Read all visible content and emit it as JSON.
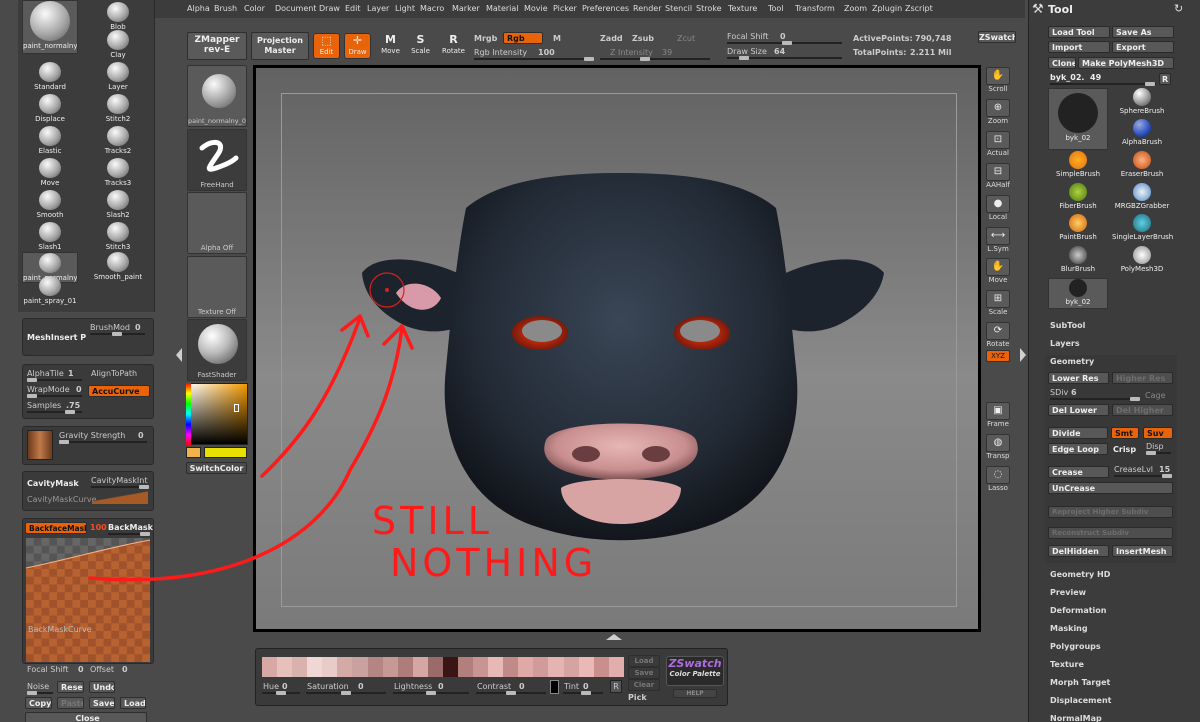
{
  "menu": [
    "Alpha",
    "Brush",
    "Color",
    "Document",
    "Draw",
    "Edit",
    "Layer",
    "Light",
    "Macro",
    "Marker",
    "Material",
    "Movie",
    "Picker",
    "Preferences",
    "Render",
    "Stencil",
    "Stroke",
    "Texture",
    "Tool",
    "Transform",
    "Zoom",
    "Zplugin",
    "Zscript"
  ],
  "topbar": {
    "zmapper": "ZMapper",
    "zmapper_sub": "rev-E",
    "projection": "Projection",
    "projection_sub": "Master",
    "edit": "Edit",
    "draw": "Draw",
    "move": "Move",
    "scale": "Scale",
    "rotate": "Rotate",
    "mrgb": "Mrgb",
    "rgb": "Rgb",
    "m": "M",
    "rgb_intensity": "Rgb Intensity",
    "rgb_intensity_value": "100",
    "zadd": "Zadd",
    "zsub": "Zsub",
    "zcut": "Zcut",
    "z_intensity": "Z Intensity",
    "z_intensity_value": "39",
    "focal_shift": "Focal Shift",
    "focal_shift_value": "0",
    "draw_size": "Draw Size",
    "draw_size_value": "64",
    "active_points": "ActivePoints:",
    "active_points_value": "790,748",
    "total_points": "TotalPoints:",
    "total_points_value": "2.211",
    "total_points_unit": "Mil",
    "zswatch": "ZSwatch"
  },
  "brushes": [
    {
      "name": "paint_normalny_0"
    },
    {
      "name": "Blob"
    },
    {
      "name": "Clay"
    },
    {
      "name": "Standard"
    },
    {
      "name": "Layer"
    },
    {
      "name": "Displace"
    },
    {
      "name": "Stitch2"
    },
    {
      "name": "Elastic"
    },
    {
      "name": "Tracks2"
    },
    {
      "name": "Move"
    },
    {
      "name": "Tracks3"
    },
    {
      "name": "Smooth"
    },
    {
      "name": "Slash2"
    },
    {
      "name": "Slash1"
    },
    {
      "name": "Stitch3"
    },
    {
      "name": "paint_normalny_0"
    },
    {
      "name": "Smooth_paint"
    },
    {
      "name": "paint_spray_01"
    }
  ],
  "leftpanel": {
    "meshinsert": "MeshInsert P",
    "brushmod": "BrushMod",
    "brushmod_value": "0",
    "alphatile": "AlphaTile",
    "alphatile_value": "1",
    "aligntopath": "AlignToPath",
    "wrapmode": "WrapMode",
    "wrapmode_value": "0",
    "accucurve": "AccuCurve",
    "samples": "Samples",
    "samples_value": ".75",
    "gravity": "Gravity Strength",
    "gravity_value": "0",
    "cavitymask": "CavityMask",
    "cavitymaskint": "CavityMaskInt",
    "cavitymaskcurve": "CavityMaskCurve",
    "backfacemask": "BackfaceMask",
    "backmask_value": "100",
    "backmask": "BackMask",
    "backmaskcurve": "BackMaskCurve",
    "focal_shift": "Focal Shift",
    "focal_shift_value": "0",
    "offset": "Offset",
    "offset_value": "0",
    "noise": "Noise",
    "reset": "Reset",
    "undo": "Undo",
    "copy": "Copy",
    "paste": "Paste",
    "save": "Save",
    "load": "Load",
    "close": "Close"
  },
  "sidecol": {
    "tile1": "paint_normalny_0",
    "tile2": "FreeHand",
    "tile3": "Alpha Off",
    "tile4": "Texture Off",
    "tile5": "FastShader",
    "switchcolor": "SwitchColor"
  },
  "vtools": [
    "Scroll",
    "Zoom",
    "Actual",
    "AAHalf",
    "Local",
    "L.Sym",
    "Move",
    "Scale",
    "Rotate",
    "XYZ",
    "Frame",
    "Transp",
    "Lasso"
  ],
  "annotation": {
    "line1": "STILL",
    "line2": "NOTHING",
    "color": "#ff1a1a"
  },
  "swatch": {
    "colors": [
      "#d8a9a4",
      "#e6c1bb",
      "#d9b2ad",
      "#eed7d4",
      "#e8ccc9",
      "#d4aaa6",
      "#c9a19e",
      "#b48583",
      "#c79995",
      "#ae7c79",
      "#d5a6a3",
      "#9c6b69",
      "#3a1515",
      "#b37f7d",
      "#c99592",
      "#e7b9b6",
      "#c08a88",
      "#dfa9a6",
      "#d09b98",
      "#e4b4b1",
      "#d6a4a0",
      "#eab8b5",
      "#c88f8d",
      "#e2aeab"
    ],
    "load": "Load",
    "save": "Save",
    "clear": "Clear",
    "brand": "ZSwatch",
    "brand_sub": "Color Palette",
    "help": "HELP",
    "hue": "Hue",
    "hue_value": "0",
    "saturation": "Saturation",
    "saturation_value": "0",
    "lightness": "Lightness",
    "lightness_value": "0",
    "contrast": "Contrast",
    "contrast_value": "0",
    "tint": "Tint",
    "tint_value": "0",
    "pick": "Pick"
  },
  "tool": {
    "title": "Tool",
    "load_tool": "Load Tool",
    "save_as": "Save As",
    "import": "Import",
    "export": "Export",
    "clone": "Clone",
    "make_polymesh": "Make PolyMesh3D",
    "current": "byk_02.",
    "current_count": "49",
    "r": "R",
    "items": [
      "byk_02",
      "SphereBrush",
      "AlphaBrush",
      "SimpleBrush",
      "EraserBrush",
      "FiberBrush",
      "MRGBZGrabber",
      "PaintBrush",
      "SingleLayerBrush",
      "BlurBrush",
      "PolyMesh3D",
      "byk_02"
    ],
    "subtool": "SubTool",
    "layers": "Layers",
    "geometry": "Geometry",
    "lower_res": "Lower Res",
    "higher_res": "Higher Res",
    "sdiv": "SDiv",
    "sdiv_value": "6",
    "cage": "Cage",
    "del_lower": "Del Lower",
    "del_higher": "Del Higher",
    "divide": "Divide",
    "smt": "Smt",
    "suv": "Suv",
    "edge_loop": "Edge Loop",
    "crisp": "Crisp",
    "disp": "Disp",
    "crease": "Crease",
    "creaselvl": "CreaseLvl",
    "creaselvl_value": "15",
    "uncrease": "UnCrease",
    "reproject": "Reproject Higher Subdiv",
    "reconstruct": "Reconstruct Subdiv",
    "delhidden": "DelHidden",
    "insertmesh": "InsertMesh",
    "sections": [
      "Geometry HD",
      "Preview",
      "Deformation",
      "Masking",
      "Polygroups",
      "Texture",
      "Morph Target",
      "Displacement",
      "NormalMap"
    ]
  }
}
